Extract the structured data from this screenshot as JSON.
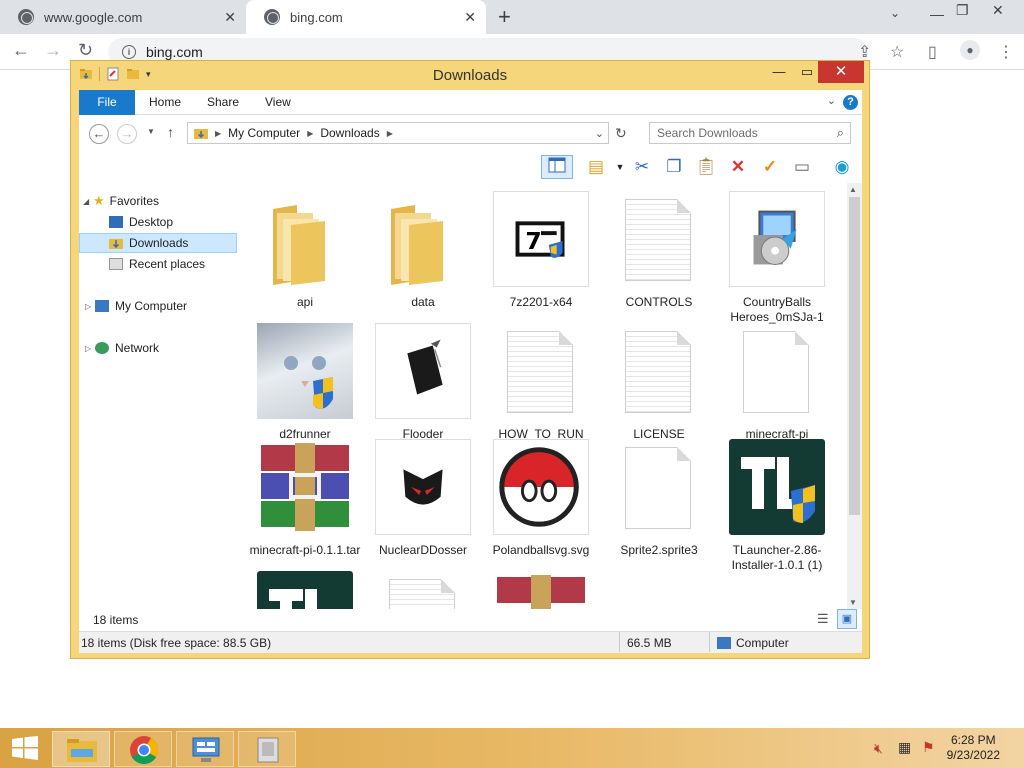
{
  "browser": {
    "tabs": [
      {
        "title": "www.google.com"
      },
      {
        "title": "bing.com"
      }
    ],
    "address": "bing.com"
  },
  "explorer": {
    "title": "Downloads",
    "ribbon_tabs": [
      "File",
      "Home",
      "Share",
      "View"
    ],
    "breadcrumb": [
      "My Computer",
      "Downloads"
    ],
    "search_placeholder": "Search Downloads",
    "nav": {
      "favorites": "Favorites",
      "desktop": "Desktop",
      "downloads": "Downloads",
      "recent": "Recent places",
      "computer": "My Computer",
      "network": "Network"
    },
    "files": [
      {
        "name": "api",
        "kind": "folder-icon"
      },
      {
        "name": "data",
        "kind": "folder-icon"
      },
      {
        "name": "7z2201-x64",
        "kind": "installer-icon"
      },
      {
        "name": "CONTROLS",
        "kind": "text-file-icon"
      },
      {
        "name": "CountryBalls Heroes_0mSJa-1",
        "kind": "setup-icon"
      },
      {
        "name": "d2frunner",
        "kind": "image-thumbnail"
      },
      {
        "name": "Flooder",
        "kind": "notebook-icon"
      },
      {
        "name": "HOW_TO_RUN",
        "kind": "text-file-icon"
      },
      {
        "name": "LICENSE",
        "kind": "text-file-icon"
      },
      {
        "name": "minecraft-pi",
        "kind": "file-icon"
      },
      {
        "name": "minecraft-pi-0.1.1.tar",
        "kind": "archive-icon"
      },
      {
        "name": "NuclearDDosser",
        "kind": "app-icon"
      },
      {
        "name": "Polandballsvg.svg",
        "kind": "image-thumbnail"
      },
      {
        "name": "Sprite2.sprite3",
        "kind": "file-icon"
      },
      {
        "name": "TLauncher-2.86-Installer-1.0.1 (1)",
        "kind": "app-icon"
      }
    ],
    "item_count": "18 items",
    "status": {
      "disk": "18 items (Disk free space: 88.5 GB)",
      "size": "66.5 MB",
      "location": "Computer"
    }
  },
  "taskbar": {
    "time": "6:28 PM",
    "date": "9/23/2022"
  }
}
